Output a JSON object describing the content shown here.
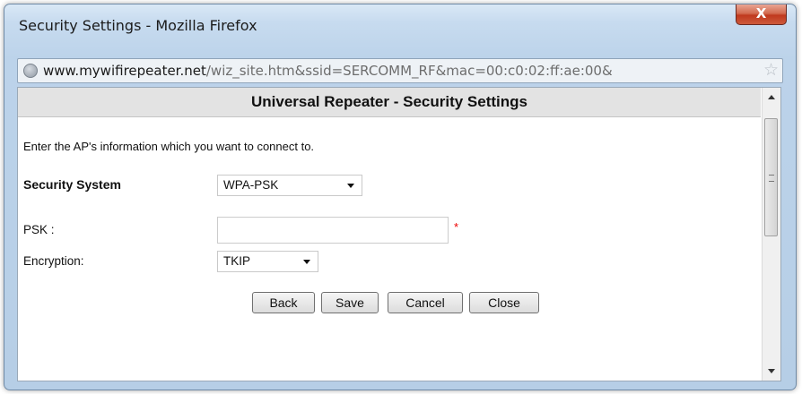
{
  "window": {
    "title": "Security Settings - Mozilla Firefox",
    "close_label": "X"
  },
  "urlbar": {
    "host": "www.mywifirepeater.net",
    "path": "/wiz_site.htm&ssid=SERCOMM_RF&mac=00:c0:02:ff:ae:00&"
  },
  "page": {
    "heading": "Universal Repeater - Security Settings",
    "intro": "Enter the AP's information which you want to connect to.",
    "security_system": {
      "label": "Security System",
      "value": "WPA-PSK"
    },
    "psk": {
      "label": "PSK :",
      "value": "",
      "required_mark": "*"
    },
    "encryption": {
      "label": "Encryption:",
      "value": "TKIP"
    },
    "buttons": {
      "back": "Back",
      "save": "Save",
      "cancel": "Cancel",
      "close": "Close"
    }
  },
  "icons": {
    "site": "globe-icon",
    "bookmark": "star-icon",
    "close": "close-icon"
  }
}
